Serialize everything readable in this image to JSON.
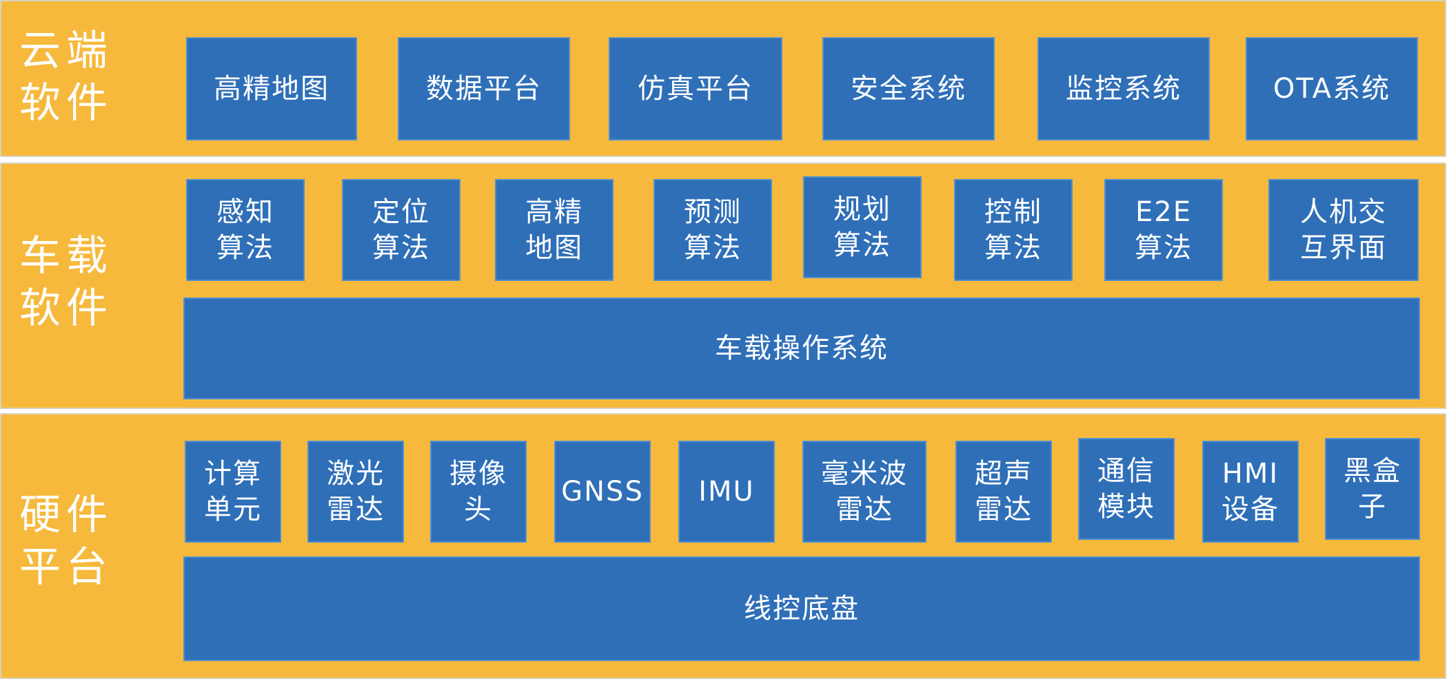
{
  "layers": {
    "cloud": {
      "label_line1": "云端",
      "label_line2": "软件",
      "items": [
        "高精地图",
        "数据平台",
        "仿真平台",
        "安全系统",
        "监控系统",
        "OTA系统"
      ]
    },
    "vehicle": {
      "label_line1": "车载",
      "label_line2": "软件",
      "items": [
        "感知算法",
        "定位算法",
        "高精地图",
        "预测算法",
        "规划算法",
        "控制算法",
        "E2E算法",
        "人机交互界面"
      ],
      "os": "车载操作系统"
    },
    "hardware": {
      "label_line1": "硬件",
      "label_line2": "平台",
      "items": [
        "计算单元",
        "激光雷达",
        "摄像头",
        "GNSS",
        "IMU",
        "毫米波雷达",
        "超声雷达",
        "通信模块",
        "HMI设备",
        "黑盒子"
      ],
      "chassis": "线控底盘"
    }
  },
  "colors": {
    "layer_background": "#f6b93c",
    "box_background": "#2f6fb8",
    "text": "#ffffff"
  }
}
